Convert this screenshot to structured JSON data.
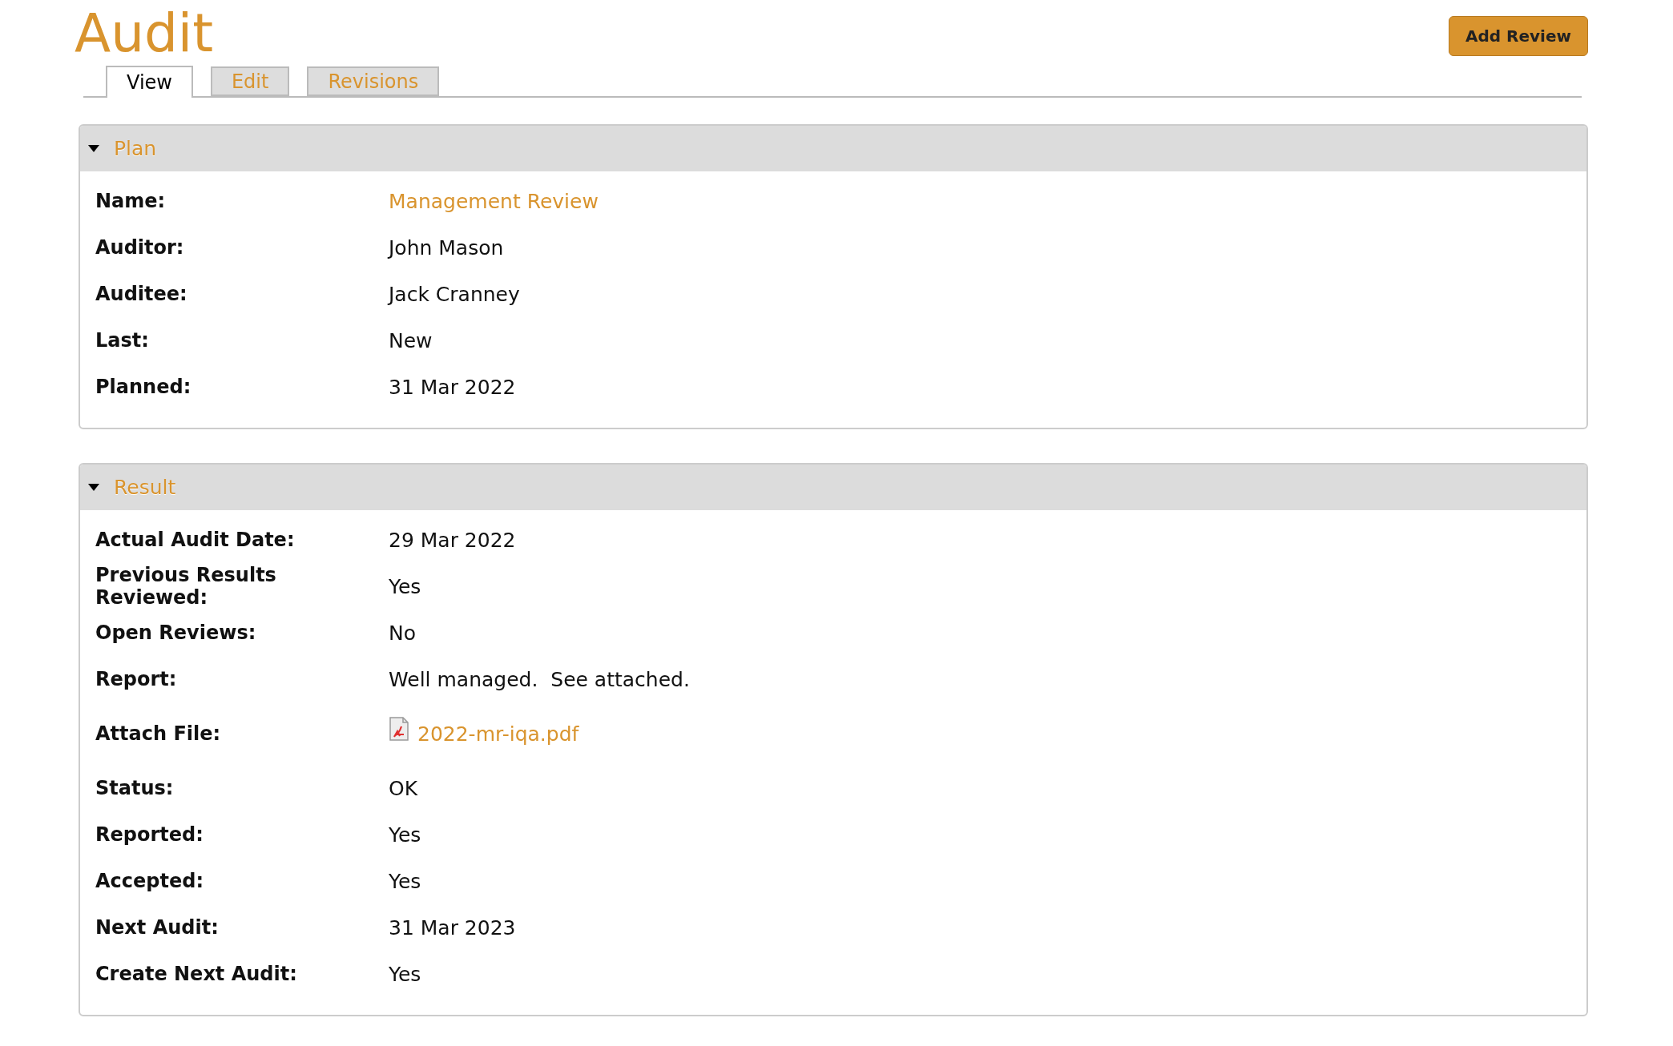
{
  "page": {
    "title": "Audit",
    "action": "Add Review"
  },
  "tabs": [
    {
      "label": "View",
      "selected": true
    },
    {
      "label": "Edit",
      "selected": false
    },
    {
      "label": "Revisions",
      "selected": false
    }
  ],
  "sections": [
    {
      "title": "Plan",
      "expanded": true,
      "fields": [
        {
          "label": "Name:",
          "value": "Management Review",
          "kind": "link"
        },
        {
          "label": "Auditor:",
          "value": "John Mason",
          "kind": "text"
        },
        {
          "label": "Auditee:",
          "value": "Jack Cranney",
          "kind": "text"
        },
        {
          "label": "Last:",
          "value": "New",
          "kind": "text"
        },
        {
          "label": "Planned:",
          "value": "31 Mar 2022",
          "kind": "text"
        }
      ]
    },
    {
      "title": "Result",
      "expanded": true,
      "fields": [
        {
          "label": "Actual Audit Date:",
          "value": "29 Mar 2022",
          "kind": "text"
        },
        {
          "label": "Previous Results Reviewed:",
          "value": "Yes",
          "kind": "text"
        },
        {
          "label": "Open Reviews:",
          "value": "No",
          "kind": "text"
        },
        {
          "label": "Report:",
          "value": "Well managed.  See attached.",
          "kind": "text"
        },
        {
          "label": "Attach File:",
          "value": "2022-mr-iqa.pdf",
          "kind": "file"
        },
        {
          "label": "Status:",
          "value": "OK",
          "kind": "text"
        },
        {
          "label": "Reported:",
          "value": "Yes",
          "kind": "text"
        },
        {
          "label": "Accepted:",
          "value": "Yes",
          "kind": "text"
        },
        {
          "label": "Next Audit:",
          "value": "31 Mar 2023",
          "kind": "text"
        },
        {
          "label": "Create Next Audit:",
          "value": "Yes",
          "kind": "text"
        }
      ]
    }
  ]
}
